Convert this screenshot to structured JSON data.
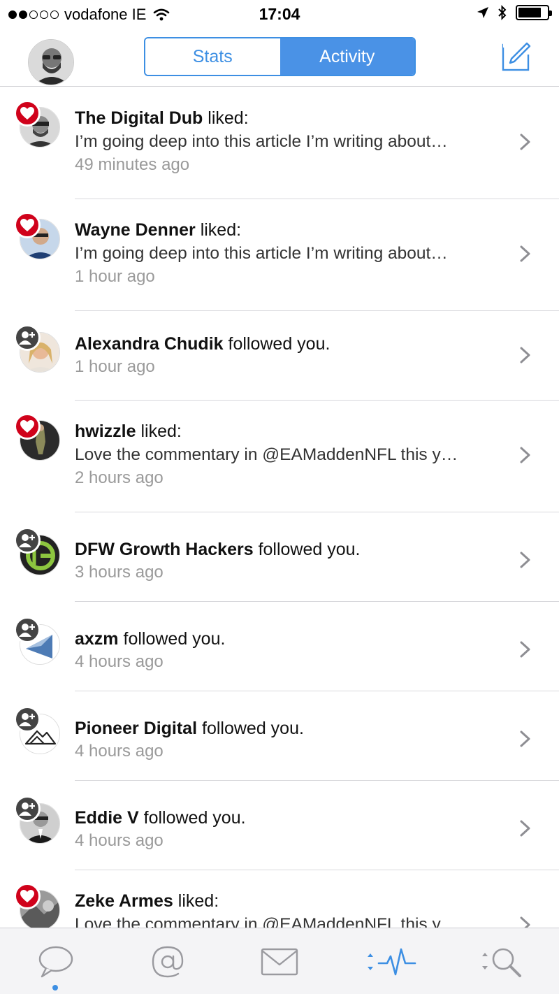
{
  "status_bar": {
    "carrier": "vodafone IE",
    "time": "17:04",
    "battery_level": 0.8
  },
  "nav": {
    "segments": [
      "Stats",
      "Activity"
    ],
    "active_segment": "Activity"
  },
  "colors": {
    "accent": "#4a92e6",
    "like_badge": "#d0021b",
    "follow_badge": "#444444",
    "secondary_text": "#9a9a9a"
  },
  "feed": [
    {
      "name": "The Digital Dub",
      "action": "liked:",
      "snippet": "I’m going deep into this article I’m writing about…",
      "time": "49 minutes ago",
      "type": "like"
    },
    {
      "name": "Wayne Denner",
      "action": "liked:",
      "snippet": "I’m going deep into this article I’m writing about…",
      "time": "1 hour ago",
      "type": "like"
    },
    {
      "name": "Alexandra Chudik",
      "action": "followed you.",
      "snippet": "",
      "time": "1 hour ago",
      "type": "follow"
    },
    {
      "name": "hwizzle",
      "action": "liked:",
      "snippet": "Love the commentary in @EAMaddenNFL this y…",
      "time": "2 hours ago",
      "type": "like"
    },
    {
      "name": "DFW Growth Hackers",
      "action": "followed you.",
      "snippet": "",
      "time": "3 hours ago",
      "type": "follow"
    },
    {
      "name": "axzm",
      "action": "followed you.",
      "snippet": "",
      "time": "4 hours ago",
      "type": "follow"
    },
    {
      "name": "Pioneer Digital",
      "action": "followed you.",
      "snippet": "",
      "time": "4 hours ago",
      "type": "follow"
    },
    {
      "name": "Eddie V",
      "action": "followed you.",
      "snippet": "",
      "time": "4 hours ago",
      "type": "follow"
    },
    {
      "name": "Zeke Armes",
      "action": "liked:",
      "snippet": "Love the commentary in @EAMaddenNFL this y…",
      "time": "",
      "type": "like"
    }
  ],
  "tab_bar": {
    "icons": [
      "speech-bubble-icon",
      "mention-icon",
      "envelope-icon",
      "activity-pulse-icon",
      "search-icon"
    ],
    "active_tab": "activity-pulse-icon",
    "unread_dot_tab": "speech-bubble-icon"
  }
}
